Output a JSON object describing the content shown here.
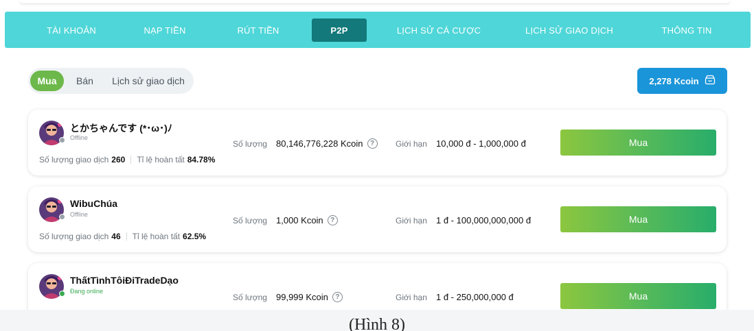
{
  "nav": {
    "tabs": [
      {
        "label": "TÀI KHOẢN"
      },
      {
        "label": "NẠP TIỀN"
      },
      {
        "label": "RÚT TIỀN"
      },
      {
        "label": "P2P",
        "active": true
      },
      {
        "label": "LỊCH SỬ CÁ CƯỢC"
      },
      {
        "label": "LỊCH SỬ GIAO DỊCH"
      },
      {
        "label": "THÔNG TIN"
      }
    ]
  },
  "segment": {
    "items": [
      {
        "label": "Mua",
        "active": true
      },
      {
        "label": "Bán"
      },
      {
        "label": "Lịch sử giao dịch"
      }
    ]
  },
  "balance": {
    "label": "2,278 Kcoin",
    "icon": "wallet-icon"
  },
  "labels": {
    "quantity": "Số lượng",
    "limit": "Giới hạn",
    "tx_count": "Số lượng giao dịch",
    "completion": "Tỉ lệ hoàn tất",
    "buy": "Mua"
  },
  "offers": [
    {
      "username": "とかちゃんです (*･ω･)ﾉ",
      "status": "Offline",
      "online": false,
      "tx_count": "260",
      "completion": "84.78%",
      "quantity": "80,146,776,228 Kcoin",
      "limit": "10,000 đ - 1,000,000 đ"
    },
    {
      "username": "WibuChúa",
      "status": "Offline",
      "online": false,
      "tx_count": "46",
      "completion": "62.5%",
      "quantity": "1,000 Kcoin",
      "limit": "1 đ - 100,000,000,000 đ"
    },
    {
      "username": "ThấtTìnhTôiĐiTradeDạo",
      "status": "Đang online",
      "online": true,
      "tx_count": "",
      "completion": "",
      "quantity": "99,999 Kcoin",
      "limit": "1 đ - 250,000,000 đ"
    }
  ],
  "colors": {
    "nav_bg": "#4fd6d8",
    "nav_active": "#13797a",
    "segment_active": "#6cb84a",
    "balance_bg": "#1b95d9",
    "offline_dot": "#9aa3aa",
    "online_dot": "#3aaa52"
  },
  "caption": "(Hình 8)"
}
